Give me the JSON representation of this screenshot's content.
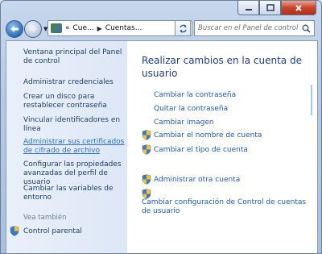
{
  "address": {
    "crumbs": [
      "Cue...",
      "Cuentas..."
    ],
    "prefix": "«"
  },
  "search": {
    "placeholder": "Buscar en el Panel de control"
  },
  "sidebar": {
    "items": [
      {
        "label": "Ventana principal del Panel de control"
      },
      {
        "label": "Administrar credenciales"
      },
      {
        "label": "Crear un disco para restablecer contraseña"
      },
      {
        "label": "Vincular identificadores en línea"
      },
      {
        "label": "Administrar sus certificados de cifrado de archivo"
      },
      {
        "label": "Configurar las propiedades avanzadas del perfil de usuario"
      },
      {
        "label": "Cambiar las variables de entorno"
      }
    ],
    "see_also_label": "Vea también",
    "see_also_items": [
      {
        "label": "Control parental"
      }
    ]
  },
  "main": {
    "title": "Realizar cambios en la cuenta de usuario",
    "links": [
      {
        "label": "Cambiar la contraseña"
      },
      {
        "label": "Quitar la contraseña"
      },
      {
        "label": "Cambiar imagen"
      },
      {
        "label": "Cambiar el nombre de cuenta"
      },
      {
        "label": "Cambiar el tipo de cuenta"
      }
    ],
    "other_links": [
      {
        "label": "Administrar otra cuenta"
      },
      {
        "label": "Cambiar configuración de Control de cuentas de usuario"
      }
    ]
  },
  "colors": {
    "link": "#1e5bcd",
    "title": "#1e3d8f",
    "sidebar_link": "#1d3d6e"
  }
}
